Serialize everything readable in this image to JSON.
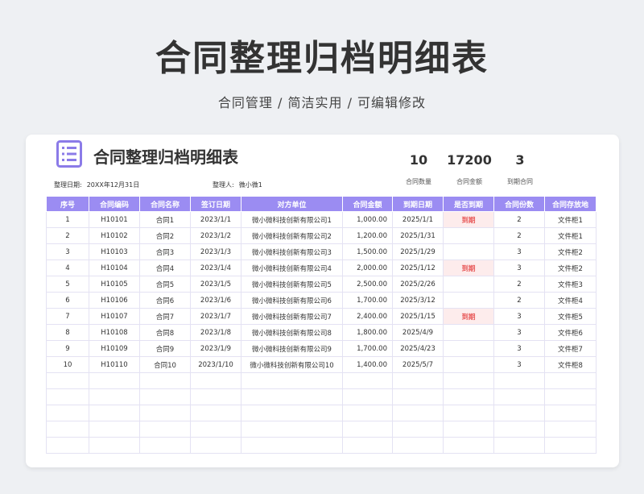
{
  "header": {
    "title": "合同整理归档明细表",
    "subtitle": "合同管理 / 简洁实用 / 可编辑修改"
  },
  "sheet": {
    "title": "合同整理归档明细表",
    "date_label": "整理日期:",
    "date_value": "20XX年12月31日",
    "person_label": "整理人:",
    "person_value": "微小微1",
    "stats": [
      {
        "value": "10",
        "label": "合同数量"
      },
      {
        "value": "17200",
        "label": "合同金额"
      },
      {
        "value": "3",
        "label": "到期合同"
      }
    ],
    "columns": [
      "序号",
      "合同编码",
      "合同名称",
      "签订日期",
      "对方单位",
      "合同金额",
      "到期日期",
      "是否到期",
      "合同份数",
      "合同存放地"
    ],
    "rows": [
      [
        "1",
        "H10101",
        "合同1",
        "2023/1/1",
        "微小微科技创新有限公司1",
        "1,000.00",
        "2025/1/1",
        "到期",
        "2",
        "文件柜1"
      ],
      [
        "2",
        "H10102",
        "合同2",
        "2023/1/2",
        "微小微科技创新有限公司2",
        "1,200.00",
        "2025/1/31",
        "",
        "2",
        "文件柜1"
      ],
      [
        "3",
        "H10103",
        "合同3",
        "2023/1/3",
        "微小微科技创新有限公司3",
        "1,500.00",
        "2025/1/29",
        "",
        "3",
        "文件柜2"
      ],
      [
        "4",
        "H10104",
        "合同4",
        "2023/1/4",
        "微小微科技创新有限公司4",
        "2,000.00",
        "2025/1/12",
        "到期",
        "3",
        "文件柜2"
      ],
      [
        "5",
        "H10105",
        "合同5",
        "2023/1/5",
        "微小微科技创新有限公司5",
        "2,500.00",
        "2025/2/26",
        "",
        "2",
        "文件柜3"
      ],
      [
        "6",
        "H10106",
        "合同6",
        "2023/1/6",
        "微小微科技创新有限公司6",
        "1,700.00",
        "2025/3/12",
        "",
        "2",
        "文件柜4"
      ],
      [
        "7",
        "H10107",
        "合同7",
        "2023/1/7",
        "微小微科技创新有限公司7",
        "2,400.00",
        "2025/1/15",
        "到期",
        "3",
        "文件柜5"
      ],
      [
        "8",
        "H10108",
        "合同8",
        "2023/1/8",
        "微小微科技创新有限公司8",
        "1,800.00",
        "2025/4/9",
        "",
        "3",
        "文件柜6"
      ],
      [
        "9",
        "H10109",
        "合同9",
        "2023/1/9",
        "微小微科技创新有限公司9",
        "1,700.00",
        "2025/4/23",
        "",
        "3",
        "文件柜7"
      ],
      [
        "10",
        "H10110",
        "合同10",
        "2023/1/10",
        "微小微科技创新有限公司10",
        "1,400.00",
        "2025/5/7",
        "",
        "3",
        "文件柜8"
      ]
    ],
    "empty_rows": 5
  },
  "colors": {
    "header_bg": "#9b8cf2",
    "accent": "#8b7be8",
    "due_text": "#e85a5a",
    "due_bg": "#fdecec"
  },
  "icons": {
    "sheet_icon": "document-list-icon"
  }
}
